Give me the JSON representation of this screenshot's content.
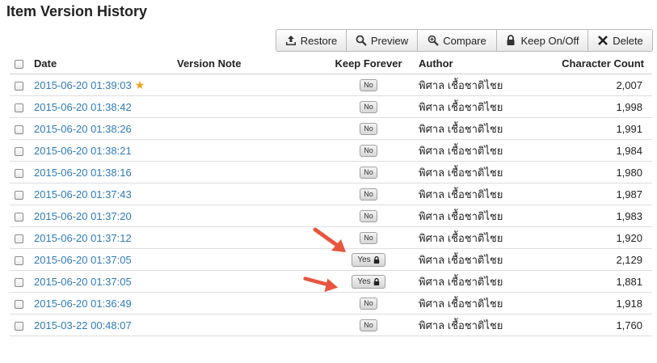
{
  "page": {
    "title": "Item Version History"
  },
  "toolbar": {
    "buttons": [
      {
        "label": "Restore",
        "icon": "upload-icon"
      },
      {
        "label": "Preview",
        "icon": "search-icon"
      },
      {
        "label": "Compare",
        "icon": "zoom-icon"
      },
      {
        "label": "Keep On/Off",
        "icon": "lock-icon"
      },
      {
        "label": "Delete",
        "icon": "close-icon"
      }
    ]
  },
  "table": {
    "headers": {
      "date": "Date",
      "note": "Version Note",
      "keep": "Keep Forever",
      "author": "Author",
      "count": "Character Count"
    },
    "rows": [
      {
        "date": "2015-06-20 01:39:03",
        "starred": true,
        "note": "",
        "keep": "No",
        "locked": false,
        "author": "พิศาล เชื้อชาติไชย",
        "count": "2,007"
      },
      {
        "date": "2015-06-20 01:38:42",
        "starred": false,
        "note": "",
        "keep": "No",
        "locked": false,
        "author": "พิศาล เชื้อชาติไชย",
        "count": "1,998"
      },
      {
        "date": "2015-06-20 01:38:26",
        "starred": false,
        "note": "",
        "keep": "No",
        "locked": false,
        "author": "พิศาล เชื้อชาติไชย",
        "count": "1,991"
      },
      {
        "date": "2015-06-20 01:38:21",
        "starred": false,
        "note": "",
        "keep": "No",
        "locked": false,
        "author": "พิศาล เชื้อชาติไชย",
        "count": "1,984"
      },
      {
        "date": "2015-06-20 01:38:16",
        "starred": false,
        "note": "",
        "keep": "No",
        "locked": false,
        "author": "พิศาล เชื้อชาติไชย",
        "count": "1,980"
      },
      {
        "date": "2015-06-20 01:37:43",
        "starred": false,
        "note": "",
        "keep": "No",
        "locked": false,
        "author": "พิศาล เชื้อชาติไชย",
        "count": "1,987"
      },
      {
        "date": "2015-06-20 01:37:20",
        "starred": false,
        "note": "",
        "keep": "No",
        "locked": false,
        "author": "พิศาล เชื้อชาติไชย",
        "count": "1,983"
      },
      {
        "date": "2015-06-20 01:37:12",
        "starred": false,
        "note": "",
        "keep": "No",
        "locked": false,
        "author": "พิศาล เชื้อชาติไชย",
        "count": "1,920"
      },
      {
        "date": "2015-06-20 01:37:05",
        "starred": false,
        "note": "",
        "keep": "Yes",
        "locked": true,
        "author": "พิศาล เชื้อชาติไชย",
        "count": "2,129"
      },
      {
        "date": "2015-06-20 01:37:05",
        "starred": false,
        "note": "",
        "keep": "Yes",
        "locked": true,
        "author": "พิศาล เชื้อชาติไชย",
        "count": "1,881"
      },
      {
        "date": "2015-06-20 01:36:49",
        "starred": false,
        "note": "",
        "keep": "No",
        "locked": false,
        "author": "พิศาล เชื้อชาติไชย",
        "count": "1,918"
      },
      {
        "date": "2015-03-22 00:48:07",
        "starred": false,
        "note": "",
        "keep": "No",
        "locked": false,
        "author": "พิศาล เชื้อชาติไชย",
        "count": "1,760"
      }
    ]
  },
  "colors": {
    "link": "#2f7bb8",
    "star": "#f0a020",
    "arrow": "#e8553f"
  }
}
